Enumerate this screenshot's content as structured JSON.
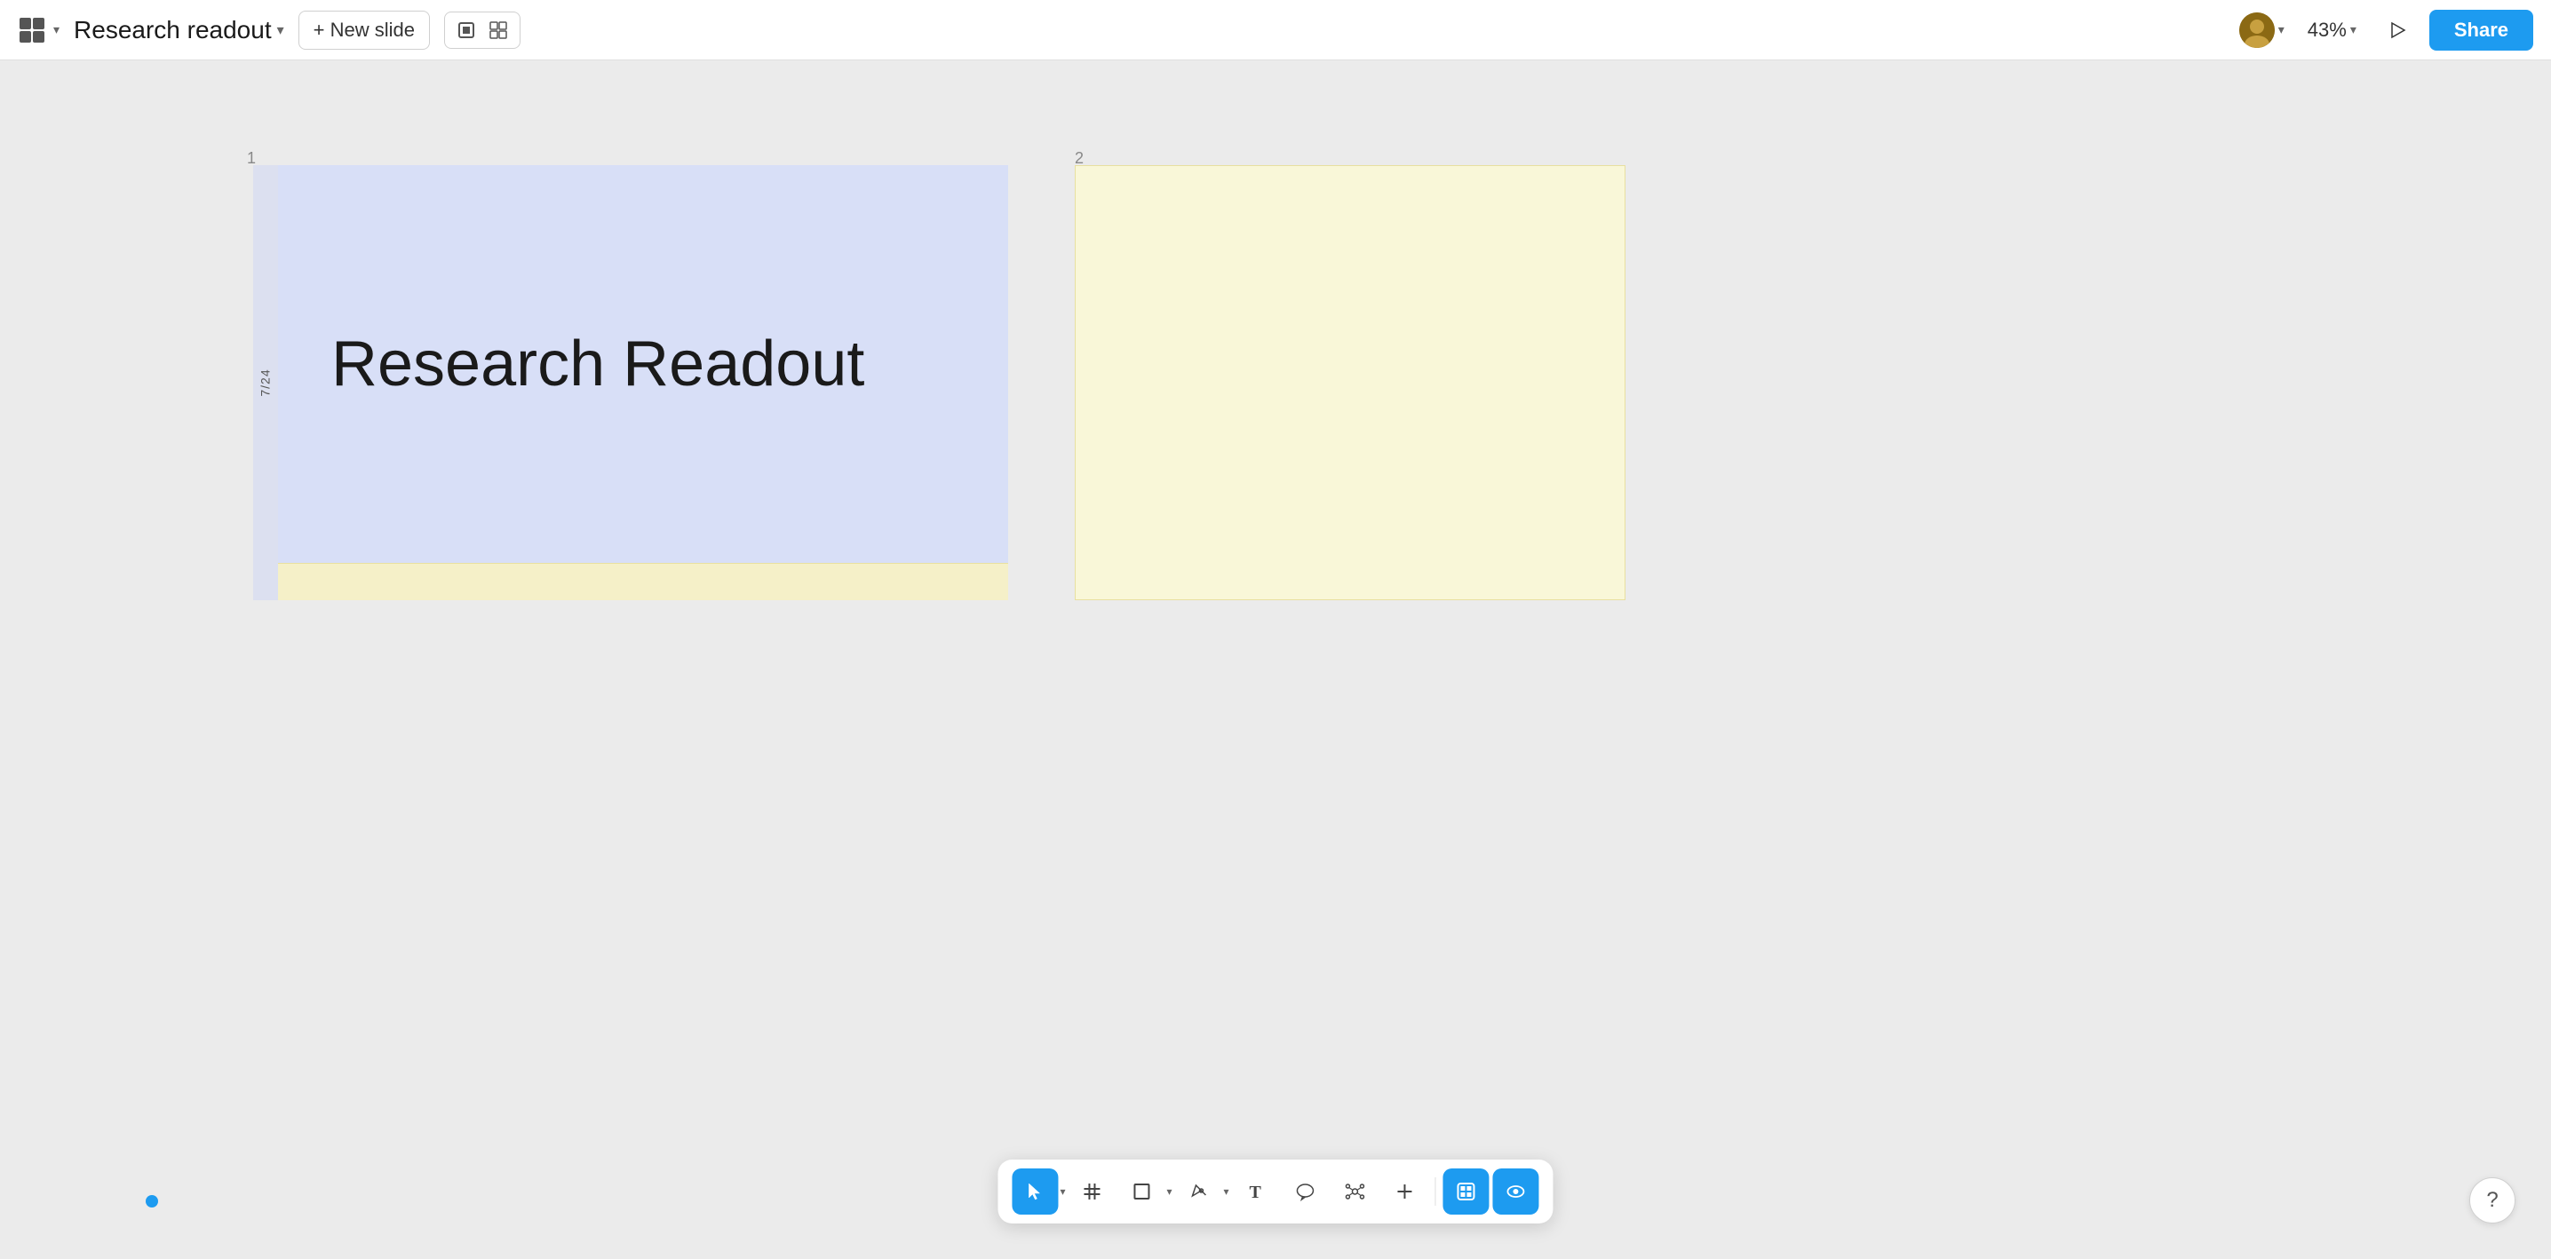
{
  "topbar": {
    "doc_title": "Research readout",
    "new_slide_label": "+ New slide",
    "zoom_level": "43%",
    "share_label": "Share"
  },
  "slides": [
    {
      "number": "1",
      "title": "Research Readout",
      "tab_text": "7/24",
      "bg_color": "#d8dff7",
      "footer_color": "#f5f0c8"
    },
    {
      "number": "2",
      "bg_color": "#f9f7d8"
    }
  ],
  "toolbar": {
    "tools": [
      {
        "id": "select",
        "icon": "▲",
        "active": true,
        "has_dropdown": true
      },
      {
        "id": "grid",
        "icon": "#",
        "active": false,
        "has_dropdown": false
      },
      {
        "id": "shape",
        "icon": "□",
        "active": false,
        "has_dropdown": true
      },
      {
        "id": "pen",
        "icon": "✏",
        "active": false,
        "has_dropdown": true
      },
      {
        "id": "text",
        "icon": "T",
        "active": false,
        "has_dropdown": false
      },
      {
        "id": "bubble",
        "icon": "◯",
        "active": false,
        "has_dropdown": false
      },
      {
        "id": "star",
        "icon": "✳",
        "active": false,
        "has_dropdown": false
      },
      {
        "id": "plus",
        "icon": "+",
        "active": false,
        "has_dropdown": false
      }
    ],
    "right_toggle": {
      "icon1": "◉",
      "icon2": "👁"
    }
  },
  "help": "?",
  "blue_dot": true
}
